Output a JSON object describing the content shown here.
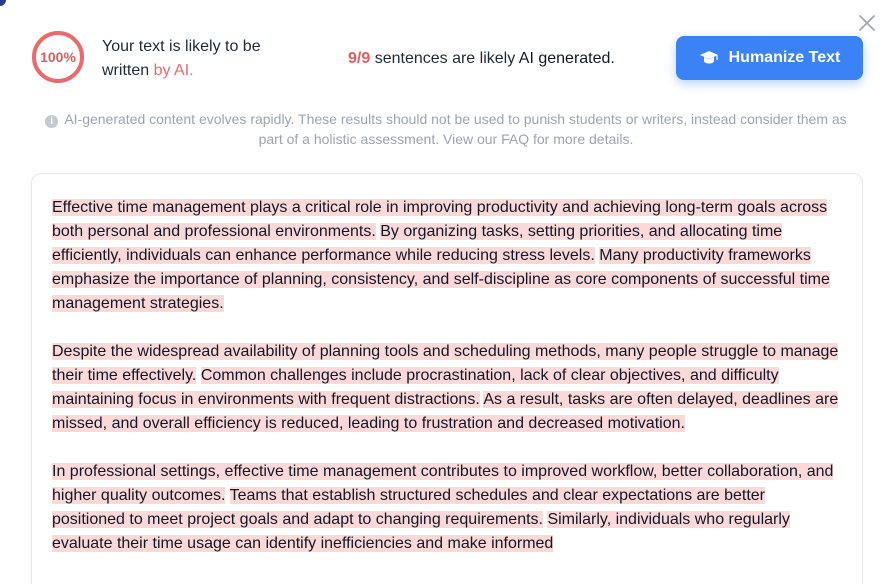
{
  "score": {
    "value": "100%",
    "percent": 100,
    "ring_color": "#e96b6b"
  },
  "verdict": {
    "prefix": "Your text is likely to be written ",
    "highlight": "by AI."
  },
  "sentence_count": {
    "count": "9/9",
    "middle": " sentences are likely ",
    "emphasis": "AI generated."
  },
  "humanize_button": {
    "label": "Humanize Text",
    "icon": "graduation-cap-icon",
    "color": "#3b82f6"
  },
  "disclaimer": {
    "icon": "info-icon",
    "text": "AI-generated content evolves rapidly. These results should not be used to punish students or writers, instead consider them as part of a holistic assessment. View our FAQ for more details."
  },
  "close_icon": "close-icon",
  "highlight_color": "#fbd9d9",
  "paragraphs": [
    {
      "sentences": [
        "Effective time management plays a critical role in improving productivity and achieving long-term goals across both personal and professional environments.",
        "By organizing tasks, setting priorities, and allocating time efficiently, individuals can enhance performance while reducing stress levels.",
        "Many productivity frameworks emphasize the importance of planning, consistency, and self-discipline as core components of successful time management strategies."
      ]
    },
    {
      "sentences": [
        "Despite the widespread availability of planning tools and scheduling methods, many people struggle to manage their time effectively.",
        "Common challenges include procrastination, lack of clear objectives, and difficulty maintaining focus in environments with frequent distractions.",
        "As a result, tasks are often delayed, deadlines are missed, and overall efficiency is reduced, leading to frustration and decreased motivation."
      ]
    },
    {
      "sentences": [
        "In professional settings, effective time management contributes to improved workflow, better collaboration, and higher quality outcomes.",
        "Teams that establish structured schedules and clear expectations are better positioned to meet project goals and adapt to changing requirements.",
        "Similarly, individuals who regularly evaluate their time usage can identify inefficiencies and make informed"
      ]
    }
  ]
}
